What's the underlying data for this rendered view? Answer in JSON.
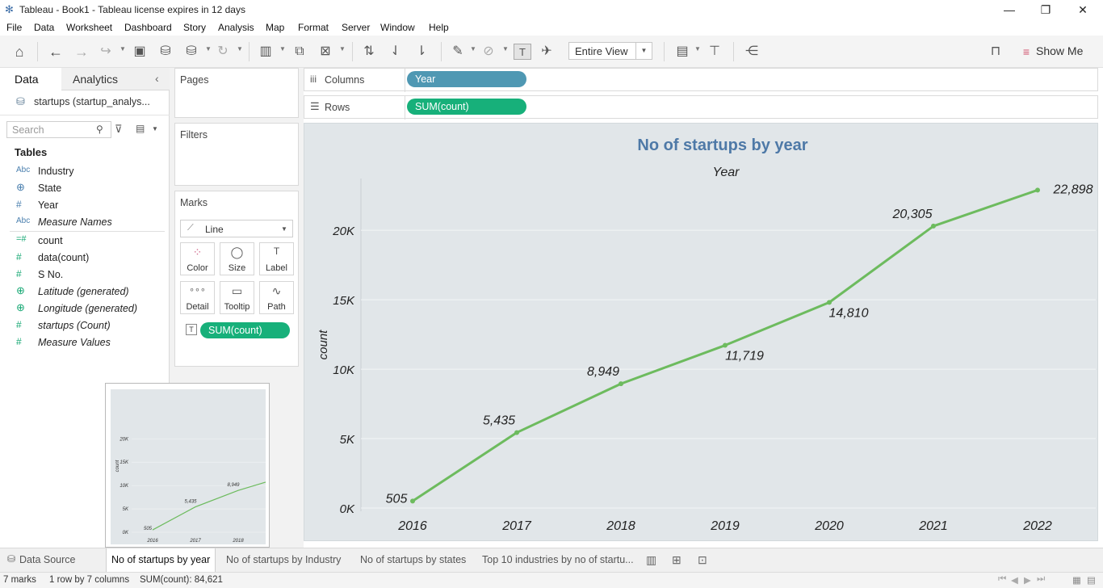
{
  "window": {
    "title": "Tableau - Book1 - Tableau license expires in 12 days",
    "minimize": "—",
    "restore": "❐",
    "close": "✕"
  },
  "menu": [
    "File",
    "Data",
    "Worksheet",
    "Dashboard",
    "Story",
    "Analysis",
    "Map",
    "Format",
    "Server",
    "Window",
    "Help"
  ],
  "toolbar": {
    "view_select": "Entire View",
    "show_me": "Show Me"
  },
  "data_pane": {
    "tabs": [
      "Data",
      "Analytics"
    ],
    "datasource": "startups (startup_analys...",
    "search_placeholder": "Search",
    "tables_heading": "Tables",
    "dimensions": [
      {
        "icon": "Abc",
        "name": "Industry"
      },
      {
        "icon": "⊕",
        "name": "State"
      },
      {
        "icon": "#",
        "name": "Year"
      },
      {
        "icon": "Abc",
        "name": "Measure Names"
      }
    ],
    "measures": [
      {
        "icon": "=#",
        "name": "count"
      },
      {
        "icon": "#",
        "name": "data(count)"
      },
      {
        "icon": "#",
        "name": "S No."
      },
      {
        "icon": "⊕",
        "name": "Latitude (generated)"
      },
      {
        "icon": "⊕",
        "name": "Longitude (generated)"
      },
      {
        "icon": "#",
        "name": "startups (Count)"
      },
      {
        "icon": "#",
        "name": "Measure Values"
      }
    ]
  },
  "cards": {
    "pages": "Pages",
    "filters": "Filters",
    "marks": "Marks",
    "mark_type": "Line",
    "mark_buttons": [
      {
        "label": "Color",
        "icon": "⁘"
      },
      {
        "label": "Size",
        "icon": "◯"
      },
      {
        "label": "Label",
        "icon": "T"
      },
      {
        "label": "Detail",
        "icon": "∘∘∘"
      },
      {
        "label": "Tooltip",
        "icon": "▭"
      },
      {
        "label": "Path",
        "icon": "∿"
      }
    ],
    "mark_pill": "SUM(count)"
  },
  "shelves": {
    "columns_label": "Columns",
    "columns_pill": "Year",
    "rows_label": "Rows",
    "rows_pill": "SUM(count)"
  },
  "chart_data": {
    "type": "line",
    "title": "No of startups by year",
    "xlabel": "Year",
    "ylabel": "count",
    "categories": [
      "2016",
      "2017",
      "2018",
      "2019",
      "2020",
      "2021",
      "2022"
    ],
    "values": [
      505,
      5435,
      8949,
      11719,
      14810,
      20305,
      22898
    ],
    "data_labels": [
      "505",
      "5,435",
      "8,949",
      "11,719",
      "14,810",
      "20,305",
      "22,898"
    ],
    "yticks": [
      0,
      5000,
      10000,
      15000,
      20000
    ],
    "ytick_labels": [
      "0K",
      "5K",
      "10K",
      "15K",
      "20K"
    ],
    "ylim": [
      0,
      23500
    ],
    "grid": true,
    "line_color": "#6dbb5e",
    "title_color": "#4e79a7"
  },
  "thumbnail": {
    "categories": [
      "2016",
      "2017",
      "2018"
    ],
    "values": [
      505,
      5435,
      8949
    ],
    "data_labels": [
      "505",
      "5,435",
      "8,949"
    ],
    "ytick_labels": [
      "0K",
      "5K",
      "10K",
      "15K",
      "20K"
    ],
    "ylabel": "count"
  },
  "sheet_tabs": [
    "Data Source",
    "No of startups by year",
    "No of startups by Industry",
    "No of startups by states",
    "Top 10 industries by no of startu..."
  ],
  "status": {
    "marks": "7 marks",
    "rows_cols": "1 row by 7 columns",
    "sum": "SUM(count): 84,621"
  }
}
